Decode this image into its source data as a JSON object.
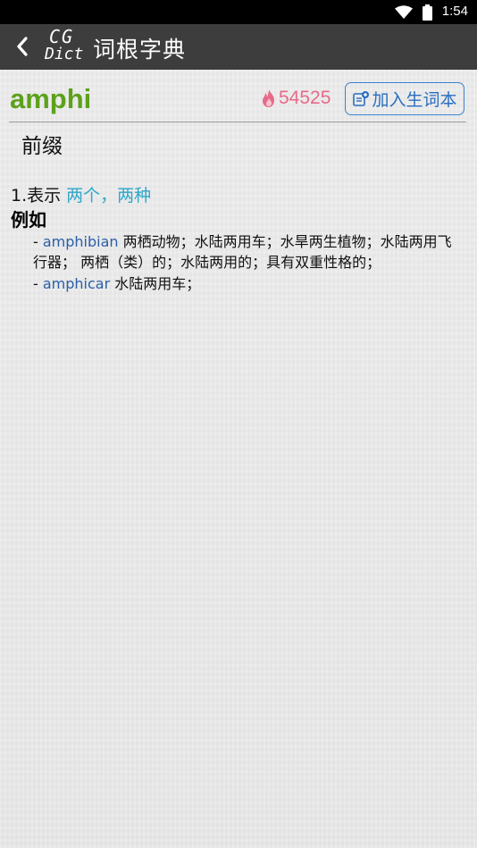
{
  "status_bar": {
    "time": "1:54"
  },
  "app_bar": {
    "logo_top": "CG",
    "logo_bottom": "Dict",
    "title": "词根字典"
  },
  "entry": {
    "root": "amphi",
    "hot_count": "54525",
    "add_button_label": "加入生词本",
    "part_of_speech": "前缀",
    "meaning": {
      "index": "1.表示 ",
      "text": "两个，两种"
    },
    "examples_label": "例如",
    "examples": [
      {
        "prefix": "- ",
        "word": "amphibian",
        "definition": " 两栖动物；水陆两用车；水旱两生植物；水陆两用飞行器； 两栖（类）的；水陆两用的；具有双重性格的；"
      },
      {
        "prefix": "- ",
        "word": "amphicar",
        "definition": " 水陆两用车；"
      }
    ]
  },
  "colors": {
    "root_green": "#5da11b",
    "hot_pink": "#e86a8a",
    "button_blue": "#3b7fd0",
    "meaning_cyan": "#2ea7c9",
    "example_link_blue": "#2a5ea8",
    "appbar_bg": "#3d3d3d"
  }
}
